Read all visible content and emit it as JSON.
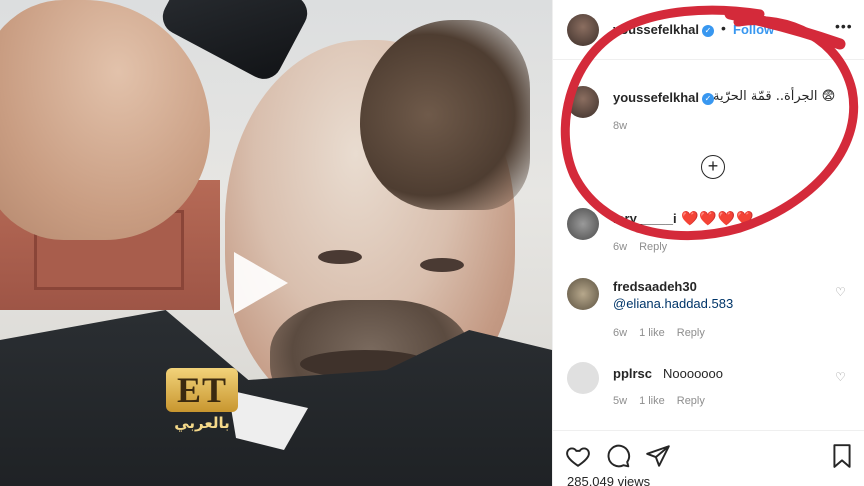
{
  "video": {
    "play_icon": "play-icon",
    "watermark": {
      "logo_text": "ET",
      "arabic_text": "بالعربي"
    }
  },
  "header": {
    "username": "youssefelkhal",
    "verified_icon": "verified-badge-icon",
    "separator": "•",
    "follow_label": "Follow",
    "more_icon": "more-options-icon"
  },
  "caption": {
    "username": "youssefelkhal",
    "text": "الجرأة.. قمّة الحرّية 😨",
    "time": "8w"
  },
  "load_more_icon": "plus-circle-icon",
  "comments": [
    {
      "username": "lory_____i",
      "text": "❤️❤️❤️❤️",
      "time": "6w",
      "likes": "",
      "reply": "Reply"
    },
    {
      "username": "fredsaadeh30",
      "text": "@eliana.haddad.583",
      "time": "6w",
      "likes": "1 like",
      "reply": "Reply"
    },
    {
      "username": "pplrsc",
      "text": "Nooooooo",
      "time": "5w",
      "likes": "1 like",
      "reply": "Reply"
    }
  ],
  "actions": {
    "like_icon": "heart-icon",
    "comment_icon": "comment-icon",
    "share_icon": "share-icon",
    "save_icon": "bookmark-icon",
    "views_text": "285,049 views"
  },
  "colors": {
    "verified": "#3897f0",
    "marker_circle": "#d42a3a",
    "hearts": "#e0102a"
  }
}
